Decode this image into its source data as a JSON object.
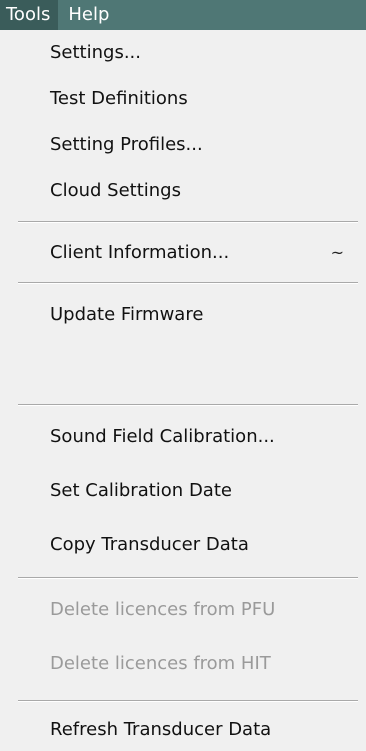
{
  "menubar": {
    "tools_label": "Tools",
    "help_label": "Help"
  },
  "menu": {
    "items": [
      {
        "label": "Settings..."
      },
      {
        "label": "Test Definitions"
      },
      {
        "label": "Setting Profiles..."
      },
      {
        "label": "Cloud Settings"
      },
      {
        "label": "Client Information...",
        "shortcut": "~"
      },
      {
        "label": "Update Firmware"
      },
      {
        "label": "Sound Field Calibration..."
      },
      {
        "label": "Set Calibration Date"
      },
      {
        "label": "Copy Transducer Data"
      },
      {
        "label": "Delete licences from PFU",
        "disabled": true
      },
      {
        "label": "Delete licences from HIT",
        "disabled": true
      },
      {
        "label": "Refresh Transducer Data"
      }
    ]
  },
  "colors": {
    "menubar_bg": "#4f7775",
    "active_menubar_bg": "#3a5c5a",
    "menu_bg": "#f0f0f0",
    "disabled_text": "#9a9a9a"
  }
}
